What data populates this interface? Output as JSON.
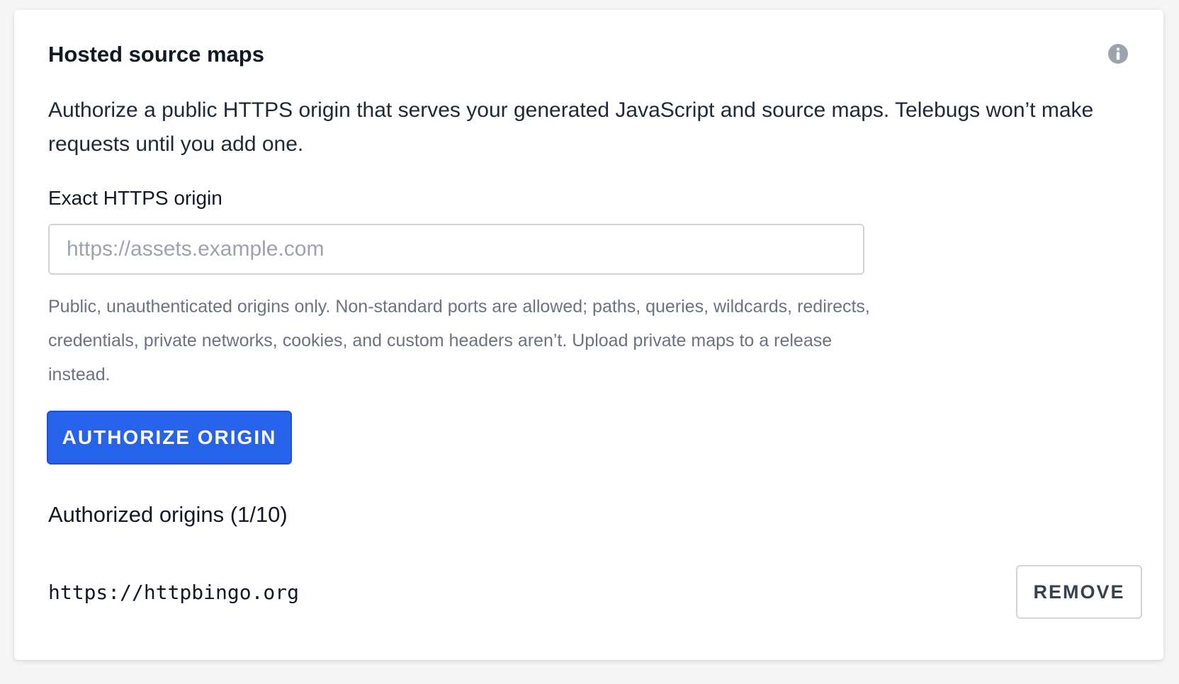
{
  "card": {
    "title": "Hosted source maps",
    "info_icon": "info-circle-icon",
    "description": "Authorize a public HTTPS origin that serves your generated JavaScript and source maps. Telebugs won’t make requests until you add one."
  },
  "form": {
    "label": "Exact HTTPS origin",
    "input_value": "",
    "input_placeholder": "https://assets.example.com",
    "hint": "Public, unauthenticated origins only. Non-standard ports are allowed; paths, queries, wildcards, redirects, credentials, private networks, cookies, and custom headers aren’t. Upload private maps to a release instead.",
    "submit_label": "AUTHORIZE ORIGIN"
  },
  "authorized": {
    "title": "Authorized origins (1/10)",
    "origins": [
      {
        "url": "https://httpbingo.org",
        "remove_label": "REMOVE"
      }
    ]
  },
  "colors": {
    "primary": "#2563eb",
    "text": "#111827",
    "muted": "#6b7280",
    "border": "#d1d5db",
    "icon": "#9ca3af"
  }
}
